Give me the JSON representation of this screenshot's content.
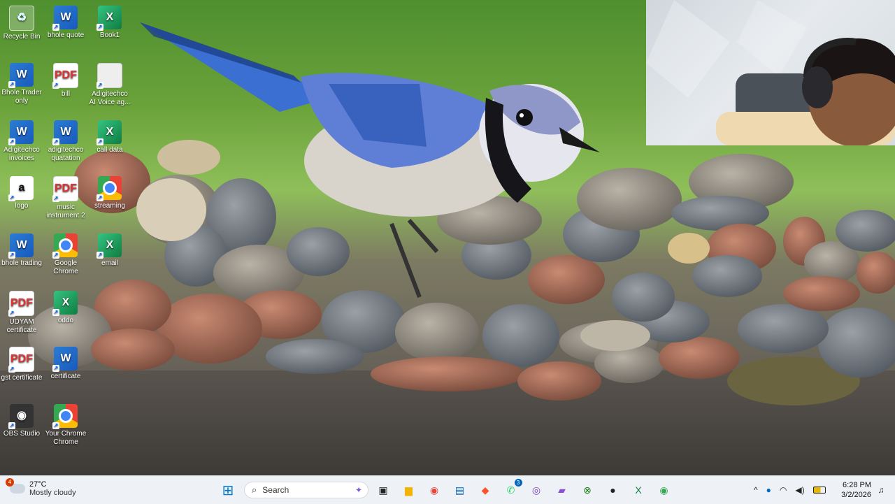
{
  "desktop": {
    "icons": [
      {
        "label": "Recycle Bin",
        "kind": "recycle",
        "glyph": "♻"
      },
      {
        "label": "bhole quote",
        "kind": "word",
        "glyph": "W"
      },
      {
        "label": "Book1",
        "kind": "excel",
        "glyph": "X"
      },
      {
        "label": "Bhole Trader only",
        "kind": "word",
        "glyph": "W"
      },
      {
        "label": "bill",
        "kind": "pdf",
        "glyph": "PDF"
      },
      {
        "label": "Adigitechco AI Voice ag...",
        "kind": "thumb",
        "glyph": ""
      },
      {
        "label": "Adigitechco invoices",
        "kind": "word",
        "glyph": "W"
      },
      {
        "label": "adigitechco quatation",
        "kind": "word",
        "glyph": "W"
      },
      {
        "label": "call data",
        "kind": "excel",
        "glyph": "X"
      },
      {
        "label": "logo",
        "kind": "logo",
        "glyph": "a"
      },
      {
        "label": "music instrument 2",
        "kind": "pdf",
        "glyph": "PDF"
      },
      {
        "label": "streaming",
        "kind": "chrome",
        "glyph": ""
      },
      {
        "label": "bhole trading",
        "kind": "word",
        "glyph": "W"
      },
      {
        "label": "Google Chrome",
        "kind": "chrome",
        "glyph": ""
      },
      {
        "label": "email",
        "kind": "excel",
        "glyph": "X"
      },
      {
        "label": "UDYAM certificate",
        "kind": "pdf",
        "glyph": "PDF"
      },
      {
        "label": "oddo",
        "kind": "excel",
        "glyph": "X"
      },
      {
        "label": "gst certificate",
        "kind": "pdf",
        "glyph": "PDF"
      },
      {
        "label": "certificate",
        "kind": "word",
        "glyph": "W"
      },
      {
        "label": "OBS Studio",
        "kind": "obs",
        "glyph": "◉"
      },
      {
        "label": "Your Chrome Chrome",
        "kind": "chrome",
        "glyph": ""
      }
    ]
  },
  "taskbar": {
    "weather": {
      "temp": "27°C",
      "condition": "Mostly cloudy",
      "badge": "4"
    },
    "search_placeholder": "Search",
    "pinned": [
      {
        "name": "start",
        "glyph": "⊞",
        "color": "#0078d4"
      },
      {
        "name": "task-view",
        "glyph": "▣",
        "color": "#222"
      },
      {
        "name": "file-explorer",
        "glyph": "▆",
        "color": "#f2b400"
      },
      {
        "name": "chrome",
        "glyph": "◉",
        "color": "#ea4335"
      },
      {
        "name": "store",
        "glyph": "▤",
        "color": "#0067c0"
      },
      {
        "name": "brave",
        "glyph": "◆",
        "color": "#fb542b"
      },
      {
        "name": "whatsapp",
        "glyph": "✆",
        "color": "#25d366",
        "badge": "3"
      },
      {
        "name": "camera-app",
        "glyph": "◎",
        "color": "#7a3fbf"
      },
      {
        "name": "clipchamp",
        "glyph": "▰",
        "color": "#8a4fd6"
      },
      {
        "name": "xbox",
        "glyph": "⊗",
        "color": "#107c10"
      },
      {
        "name": "obs",
        "glyph": "●",
        "color": "#222"
      },
      {
        "name": "excel",
        "glyph": "X",
        "color": "#107c41"
      },
      {
        "name": "chrome-profile",
        "glyph": "◉",
        "color": "#34a853"
      }
    ],
    "tray": {
      "chevron": "^",
      "mic": "🎤",
      "wifi": "◠",
      "volume": "🔊",
      "battery": "▭"
    },
    "clock": {
      "time": "6:28 PM",
      "date": "3/2/2026"
    }
  }
}
